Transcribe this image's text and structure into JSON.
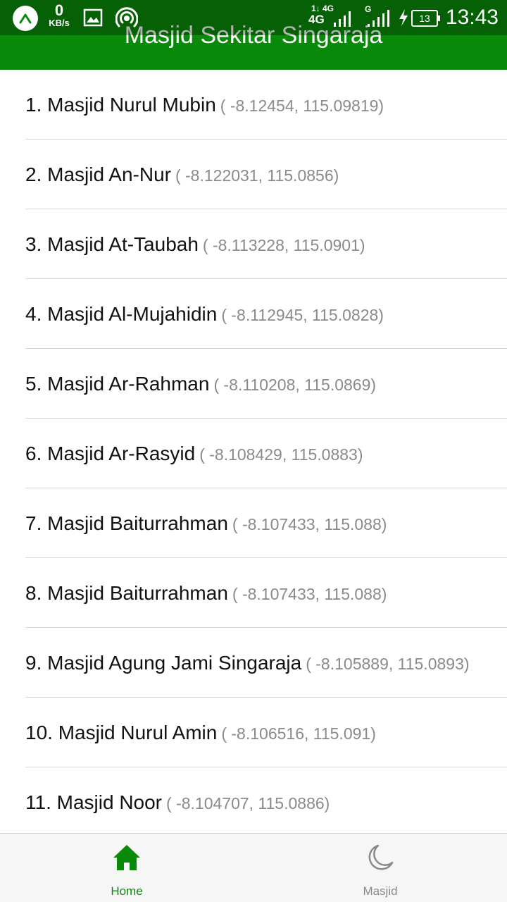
{
  "status_bar": {
    "speed_value": "0",
    "speed_unit": "KB/s",
    "network1_top": "1↓ 4G",
    "network1_bottom": "4G",
    "network2": "G",
    "battery": "13",
    "time": "13:43"
  },
  "header": {
    "title": "Masjid Sekitar Singaraja",
    "color": "#0a8a0a"
  },
  "masjid_list": [
    {
      "name": "1. Masjid Nurul Mubin",
      "coords": "( -8.12454, 115.09819)"
    },
    {
      "name": "2. Masjid An-Nur",
      "coords": "( -8.122031, 115.0856)"
    },
    {
      "name": "3. Masjid At-Taubah",
      "coords": "( -8.113228, 115.0901)"
    },
    {
      "name": "4. Masjid Al-Mujahidin",
      "coords": "( -8.112945, 115.0828)"
    },
    {
      "name": "5. Masjid Ar-Rahman",
      "coords": "( -8.110208, 115.0869)"
    },
    {
      "name": "6. Masjid Ar-Rasyid",
      "coords": "( -8.108429, 115.0883)"
    },
    {
      "name": "7. Masjid Baiturrahman",
      "coords": "( -8.107433, 115.088)"
    },
    {
      "name": "8. Masjid Baiturrahman",
      "coords": "( -8.107433, 115.088)"
    },
    {
      "name": "9. Masjid Agung Jami Singaraja",
      "coords": "( -8.105889, 115.0893)"
    },
    {
      "name": "10. Masjid Nurul Amin",
      "coords": "( -8.106516, 115.091)"
    },
    {
      "name": "11. Masjid Noor",
      "coords": "( -8.104707, 115.0886)"
    }
  ],
  "bottom_nav": {
    "tabs": [
      {
        "label": "Home",
        "icon": "home-icon",
        "active": true
      },
      {
        "label": "Masjid",
        "icon": "moon-icon",
        "active": false
      }
    ],
    "active_color": "#0a8a0a",
    "inactive_color": "#8a8a8a"
  }
}
